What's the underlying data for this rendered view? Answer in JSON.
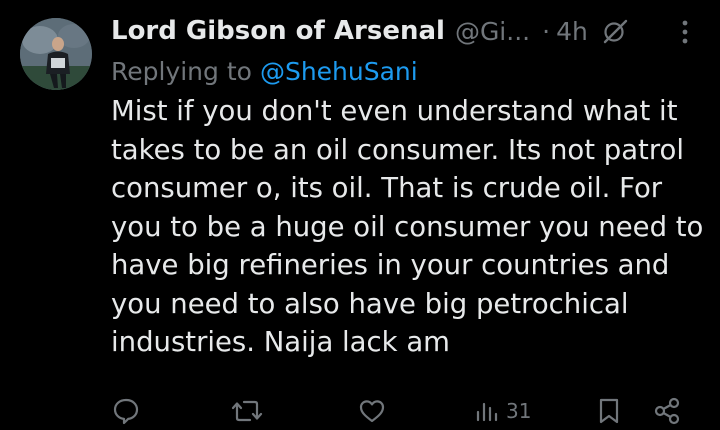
{
  "author": {
    "display_name": "Lord Gibson of Arsenal",
    "handle": "@Gi...",
    "separator": "·",
    "time": "4h"
  },
  "reply": {
    "prefix": "Replying to",
    "target_handle": "@ShehuSani"
  },
  "tweet": {
    "lines": [
      "Mist if you don't even understand what it",
      "takes to be an oil consumer. Its not patrol",
      "consumer o, its oil. That is crude oil. For",
      "you to be a huge oil consumer you need to",
      "have big refineries in your countries and",
      "you need to also have big petrochical",
      "industries. Naija lack am"
    ]
  },
  "actions": {
    "views_count": "31"
  },
  "icons": {
    "more": "more-vertical-icon",
    "grok": "grok-icon",
    "reply": "reply-icon",
    "repost": "repost-icon",
    "like": "heart-icon",
    "views": "views-chart-icon",
    "bookmark": "bookmark-icon",
    "share": "share-icon"
  },
  "colors": {
    "background": "#000000",
    "text_primary": "#e7e9ea",
    "text_secondary": "#71767b",
    "accent": "#1d9bf0"
  }
}
